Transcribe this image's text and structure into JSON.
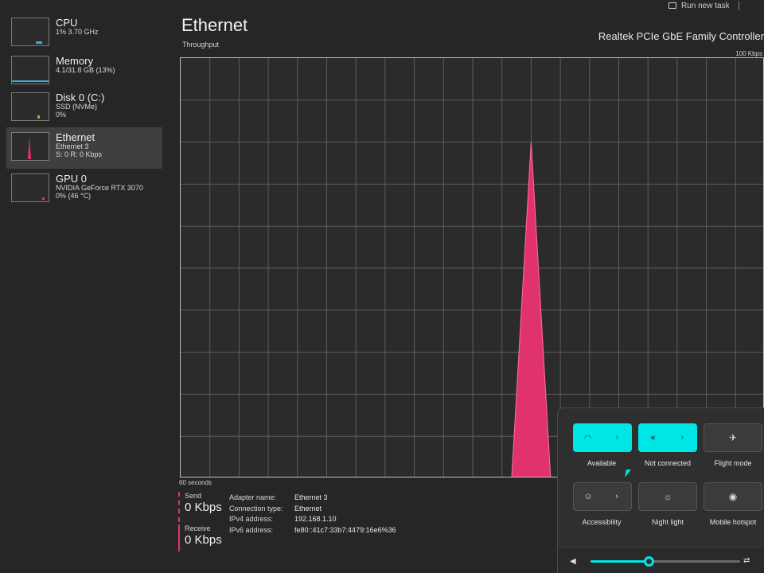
{
  "top_right": {
    "label": "Run new task"
  },
  "sidebar": {
    "items": [
      {
        "title": "CPU",
        "line1": "1% 3.70 GHz",
        "line2": "",
        "line3": ""
      },
      {
        "title": "Memory",
        "line1": "4.1/31.8 GB (13%)",
        "line2": "",
        "line3": ""
      },
      {
        "title": "Disk 0 (C:)",
        "line1": "SSD (NVMe)",
        "line2": "0%",
        "line3": ""
      },
      {
        "title": "Ethernet",
        "line1": "Ethernet 3",
        "line2": "S: 0 R: 0 Kbps",
        "line3": ""
      },
      {
        "title": "GPU 0",
        "line1": "NVIDIA GeForce RTX 3070",
        "line2": "0% (46 °C)",
        "line3": ""
      }
    ]
  },
  "header": {
    "title": "Ethernet",
    "adapter": "Realtek PCIe GbE Family Controller",
    "graph_label": "Throughput",
    "max_label": "100 Kbps",
    "time_label": "60 seconds"
  },
  "chart_data": {
    "type": "area",
    "x": [
      0,
      30,
      34,
      36,
      38,
      42,
      60
    ],
    "values": [
      0,
      0,
      0,
      80,
      0,
      0,
      0
    ],
    "ylim": [
      0,
      100
    ],
    "xlim": [
      0,
      60
    ],
    "grid": true,
    "color": "#e0336e"
  },
  "stats": {
    "send_label": "Send",
    "send_value": "0 Kbps",
    "receive_label": "Receive",
    "receive_value": "0 Kbps"
  },
  "details": [
    {
      "key": "Adapter name:",
      "value": "Ethernet 3"
    },
    {
      "key": "Connection type:",
      "value": "Ethernet"
    },
    {
      "key": "IPv4 address:",
      "value": "192.168.1.10"
    },
    {
      "key": "IPv6 address:",
      "value": "fe80::41c7:33b7:4479:16e6%36"
    }
  ],
  "quick_settings": {
    "tiles": [
      {
        "label": "Available",
        "icon": "wifi-icon",
        "state": "on"
      },
      {
        "label": "Not connected",
        "icon": "bluetooth-icon",
        "state": "on"
      },
      {
        "label": "Flight mode",
        "icon": "airplane-icon",
        "state": "off"
      },
      {
        "label": "Accessibility",
        "icon": "accessibility-icon",
        "state": "off"
      },
      {
        "label": "Night light",
        "icon": "sun-icon",
        "state": "off"
      },
      {
        "label": "Mobile hotspot",
        "icon": "hotspot-icon",
        "state": "off"
      }
    ],
    "volume_level": 0.39,
    "accent": "#00e5e5"
  }
}
